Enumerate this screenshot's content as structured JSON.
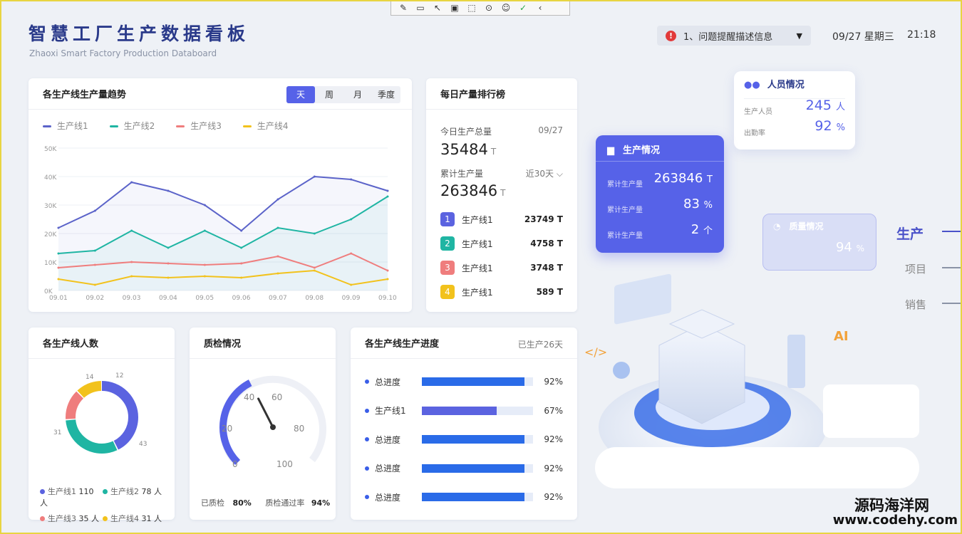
{
  "header": {
    "title": "智慧工厂生产数据看板",
    "subtitle": "Zhaoxi Smart Factory Production Databoard",
    "alert_index": "!",
    "alert_text": "1、问题提醒描述信息",
    "date": "09/27 星期三",
    "time": "21:18"
  },
  "trend": {
    "title": "各生产线生产量趋势",
    "tabs": [
      "天",
      "周",
      "月",
      "季度"
    ],
    "active_tab": "天"
  },
  "chart_data": {
    "type": "line",
    "x": [
      "09.01",
      "09.02",
      "09.03",
      "09.04",
      "09.05",
      "09.06",
      "09.07",
      "09.08",
      "09.09",
      "09.10"
    ],
    "ylim": [
      0,
      50000
    ],
    "yticks": [
      "0K",
      "10K",
      "20K",
      "30K",
      "40K",
      "50K"
    ],
    "grid": true,
    "legend_position": "top-left",
    "series": [
      {
        "name": "生产线1",
        "color": "#5b63c9",
        "values": [
          22000,
          28000,
          38000,
          35000,
          30000,
          21000,
          32000,
          40000,
          39000,
          35000
        ]
      },
      {
        "name": "生产线2",
        "color": "#1fb5a3",
        "values": [
          13000,
          14000,
          21000,
          15000,
          21000,
          15000,
          22000,
          20000,
          25000,
          33000
        ]
      },
      {
        "name": "生产线3",
        "color": "#ef7d7d",
        "values": [
          8000,
          9000,
          10000,
          9500,
          9000,
          9500,
          12000,
          8000,
          13000,
          7000
        ]
      },
      {
        "name": "生产线4",
        "color": "#f2c21c",
        "values": [
          4000,
          2000,
          5000,
          4500,
          5000,
          4500,
          6000,
          7000,
          2000,
          4000
        ]
      }
    ]
  },
  "ranking": {
    "title": "每日产量排行榜",
    "today_label": "今日生产总量",
    "today_date": "09/27",
    "today_value": "35484",
    "unit": "T",
    "total_label": "累计生产量",
    "total_range": "近30天",
    "total_value": "263846",
    "rows": [
      {
        "num": "1",
        "name": "生产线1",
        "value": "23749 T",
        "color": "#5b63e0"
      },
      {
        "num": "2",
        "name": "生产线1",
        "value": "4758 T",
        "color": "#1fb5a3"
      },
      {
        "num": "3",
        "name": "生产线1",
        "value": "3748 T",
        "color": "#ef7d7d"
      },
      {
        "num": "4",
        "name": "生产线1",
        "value": "589 T",
        "color": "#f2c21c"
      }
    ]
  },
  "people": {
    "title": "各生产线人数",
    "donut": [
      {
        "name": "生产线1",
        "value": 43,
        "color": "#5b63e0"
      },
      {
        "name": "生产线2",
        "value": 31,
        "color": "#1fb5a3"
      },
      {
        "name": "生产线3",
        "value": 14,
        "color": "#ef7d7d"
      },
      {
        "name": "生产线4",
        "value": 12,
        "color": "#f2c21c"
      }
    ],
    "donut_labels": {
      "a": "43",
      "b": "31",
      "c": "14",
      "d": "12"
    },
    "legend": [
      {
        "name": "生产线1",
        "value": "110 人",
        "color": "#5b63e0"
      },
      {
        "name": "生产线2",
        "value": "78 人",
        "color": "#1fb5a3"
      },
      {
        "name": "生产线3",
        "value": "35 人",
        "color": "#ef7d7d"
      },
      {
        "name": "生产线4",
        "value": "31 人",
        "color": "#f2c21c"
      }
    ]
  },
  "quality": {
    "title": "质检情况",
    "gauge_ticks": [
      "0",
      "20",
      "40",
      "60",
      "80",
      "100"
    ],
    "gauge_value": 40,
    "inspected_label": "已质检",
    "inspected_value": "80%",
    "pass_label": "质检通过率",
    "pass_value": "94%"
  },
  "progress": {
    "title": "各生产线生产进度",
    "days": "已生产26天",
    "rows": [
      {
        "name": "总进度",
        "pct": "92%",
        "value": 0.92,
        "color": "#2a6be8"
      },
      {
        "name": "生产线1",
        "pct": "67%",
        "value": 0.67,
        "color": "#5b63e0"
      },
      {
        "name": "总进度",
        "pct": "92%",
        "value": 0.92,
        "color": "#2a6be8"
      },
      {
        "name": "总进度",
        "pct": "92%",
        "value": 0.92,
        "color": "#2a6be8"
      },
      {
        "name": "总进度",
        "pct": "92%",
        "value": 0.92,
        "color": "#2a6be8"
      }
    ]
  },
  "staff_card": {
    "title": "人员情况",
    "row1_label": "生产人员",
    "row1_value": "245",
    "row1_unit": "人",
    "row2_label": "出勤率",
    "row2_value": "92",
    "row2_unit": "%"
  },
  "prod_card": {
    "title": "生产情况",
    "rows": [
      {
        "label": "累计生产量",
        "value": "263846",
        "unit": "T"
      },
      {
        "label": "累计生产量",
        "value": "83",
        "unit": "%"
      },
      {
        "label": "累计生产量",
        "value": "2",
        "unit": "个"
      }
    ]
  },
  "quality_card": {
    "title": "质量情况",
    "value": "94",
    "unit": "%"
  },
  "side_menu": {
    "items": [
      "生产",
      "项目",
      "销售"
    ],
    "active": "生产"
  },
  "watermark": {
    "line1": "源码海洋网",
    "line2": "www.codehy.com"
  },
  "colors": {
    "accent": "#5662e8",
    "title": "#2a3a8a",
    "border": "#e8d542"
  }
}
